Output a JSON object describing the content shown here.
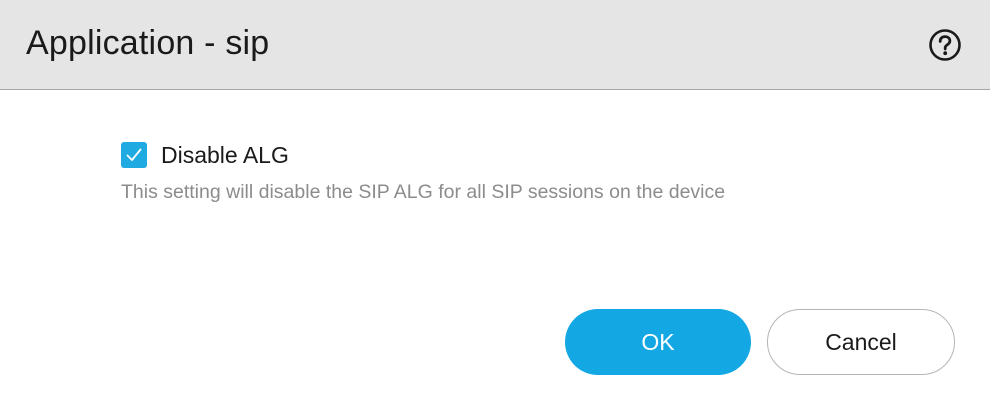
{
  "dialog": {
    "title": "Application - sip",
    "help_icon": "help-circle-icon"
  },
  "option": {
    "checked": true,
    "label": "Disable ALG",
    "hint": "This setting will disable the SIP ALG for all SIP sessions on the device"
  },
  "buttons": {
    "ok_label": "OK",
    "cancel_label": "Cancel"
  },
  "colors": {
    "accent": "#13a8e4",
    "titlebar_bg": "#e5e5e5",
    "hint_text": "#8c8c8c"
  }
}
